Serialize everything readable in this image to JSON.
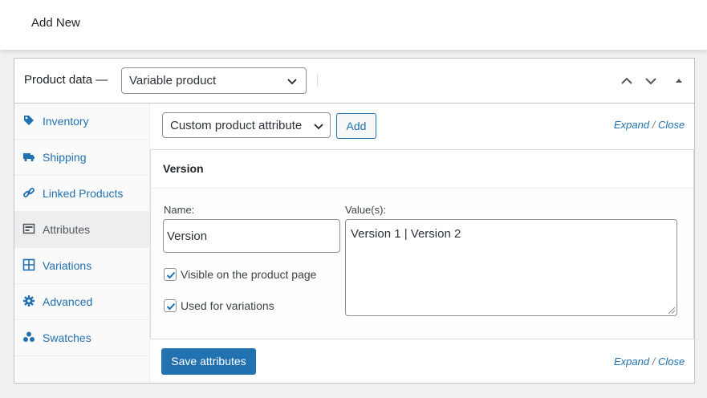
{
  "page": {
    "title": "Add New"
  },
  "product_data": {
    "label": "Product data —",
    "product_type": "Variable product",
    "header_icons": [
      "chevron-up-icon",
      "chevron-down-icon",
      "toggle-arrow-icon"
    ]
  },
  "tabs": [
    {
      "label": "Inventory",
      "icon": "tag-icon"
    },
    {
      "label": "Shipping",
      "icon": "truck-icon"
    },
    {
      "label": "Linked Products",
      "icon": "link-icon"
    },
    {
      "label": "Attributes",
      "icon": "list-icon",
      "active": true
    },
    {
      "label": "Variations",
      "icon": "grid-icon"
    },
    {
      "label": "Advanced",
      "icon": "gear-icon"
    },
    {
      "label": "Swatches",
      "icon": "swatches-icon"
    }
  ],
  "attributes": {
    "select_value": "Custom product attribute",
    "add_label": "Add",
    "expand_label": "Expand",
    "separator": "/",
    "close_label": "Close",
    "attribute": {
      "heading": "Version",
      "name_label": "Name:",
      "name_value": "Version",
      "values_label": "Value(s):",
      "values_value": "Version 1 | Version 2",
      "visible_label": "Visible on the product page",
      "visible_checked": true,
      "variations_label": "Used for variations",
      "variations_checked": true
    },
    "save_label": "Save attributes"
  },
  "colors": {
    "accent": "#2271b1",
    "border": "#c3c4c7",
    "background": "#f0f0f1"
  }
}
